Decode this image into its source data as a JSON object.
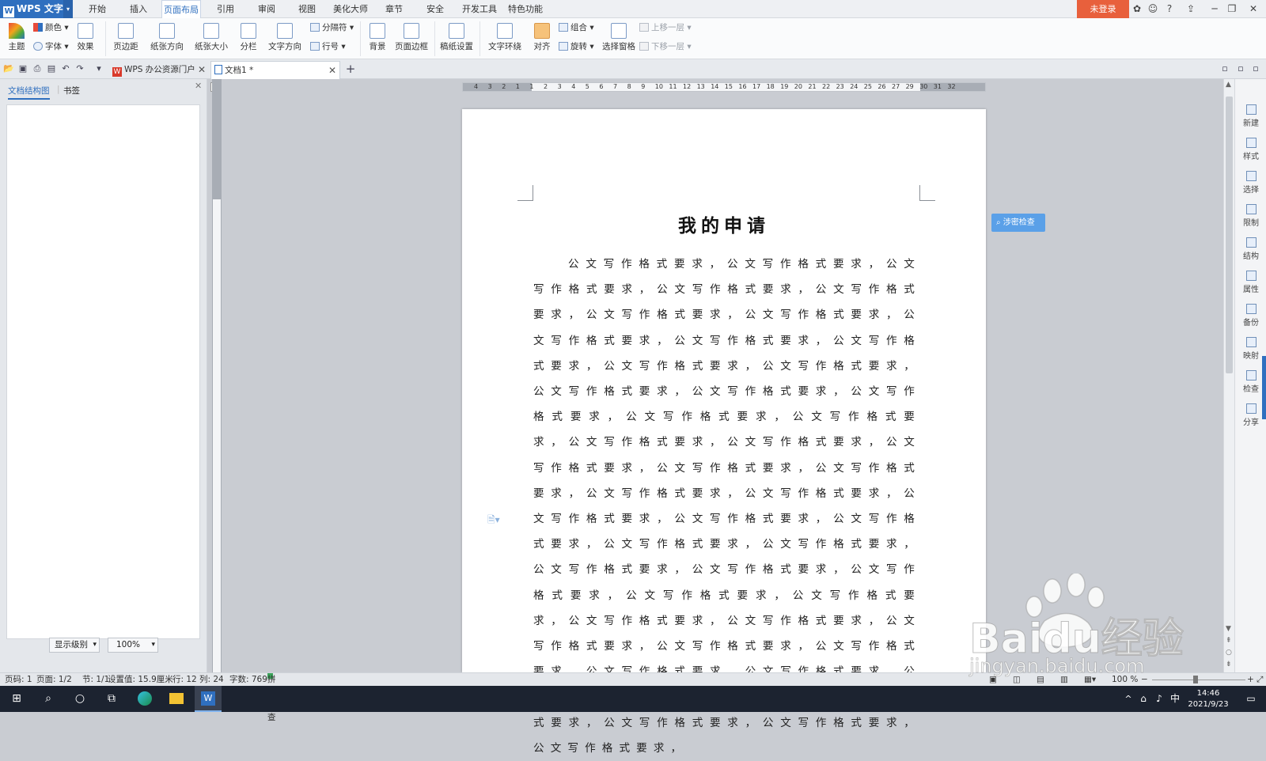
{
  "app": {
    "logo_text": "WPS 文字"
  },
  "menu": {
    "items": [
      "开始",
      "插入",
      "页面布局",
      "引用",
      "审阅",
      "视图",
      "美化大师",
      "章节",
      "安全",
      "开发工具",
      "特色功能"
    ],
    "active": "页面布局",
    "login_label": "未登录",
    "help_label": "?"
  },
  "ribbon": {
    "theme": "主题",
    "color": "颜色",
    "font": "字体",
    "effect": "效果",
    "margins": "页边距",
    "orientation": "纸张方向",
    "size": "纸张大小",
    "columns": "分栏",
    "text_direction": "文字方向",
    "separator": "分隔符",
    "line_numbers": "行号",
    "background": "背景",
    "page_border": "页面边框",
    "manuscript": "稿纸设置",
    "text_wrap": "文字环绕",
    "align": "对齐",
    "group": "组合",
    "rotate": "旋转",
    "selection_pane": "选择窗格",
    "bring_forward": "上移一层",
    "send_backward": "下移一层"
  },
  "tabs": [
    {
      "label": "WPS 办公资源门户"
    },
    {
      "label": "文档1 *"
    }
  ],
  "left_pane": {
    "tab_structure": "文档结构图",
    "tab_bookmarks": "书签",
    "level_select": "显示级别",
    "zoom_select": "100%"
  },
  "ruler": {
    "h_ticks": [
      "4",
      "3",
      "2",
      "1",
      "1",
      "2",
      "3",
      "4",
      "5",
      "6",
      "7",
      "8",
      "9",
      "10",
      "11",
      "12",
      "13",
      "14",
      "15",
      "16",
      "17",
      "18",
      "19",
      "20",
      "21",
      "22",
      "23",
      "24",
      "25",
      "26",
      "27",
      "29",
      "30",
      "31",
      "32"
    ]
  },
  "document": {
    "title": "我的申请",
    "body": "公文写作格式要求，公文写作格式要求，公文写作格式要求，公文写作格式要求，公文写作格式要求，公文写作格式要求，公文写作格式要求，公文写作格式要求，公文写作格式要求，公文写作格式要求，公文写作格式要求，公文写作格式要求，公文写作格式要求，公文写作格式要求，公文写作格式要求，公文写作格式要求，公文写作格式要求，公文写作格式要求，公文写作格式要求，公文写作格式要求，公文写作格式要求，公文写作格式要求，公文写作格式要求，公文写作格式要求，公文写作格式要求，公文写作格式要求，公文写作格式要求，公文写作格式要求，公文写作格式要求，公文写作格式要求，公文写作格式要求，公文写作格式要求，公文写作格式要求，公文写作格式要求，公文写作格式要求，公文写作格式要求，公文写作格式要求，公文写作格式要求，公文写作格式要求，公文写作格式要求，公文写作格式要求，公文写作格式要求，公文写作格式要求，公文写作格式要求，公文写作格式要求，公文写作格式要求，公文写作格式要求，"
  },
  "spell_check_float": "涉密检查",
  "right_sidebar": [
    "新建",
    "样式",
    "选择",
    "限制",
    "结构",
    "属性",
    "备份",
    "映射",
    "检查",
    "分享"
  ],
  "status": {
    "page": "页码: 1",
    "pages": "页面: 1/2",
    "section": "节: 1/1",
    "setting": "设置值: 15.9厘米",
    "row": "行: 12",
    "col": "列: 24",
    "words": "字数: 769",
    "spell": "拼写检查",
    "zoom": "100 %"
  },
  "taskbar": {
    "time": "14:46",
    "date": "2021/9/23",
    "ime": "中"
  },
  "watermark": {
    "brand": "Baidu经验",
    "url": "jingyan.baidu.com"
  },
  "colors": {
    "accent": "#2f6fbf",
    "login": "#e8603c",
    "float_btn": "#5aa0e8"
  }
}
